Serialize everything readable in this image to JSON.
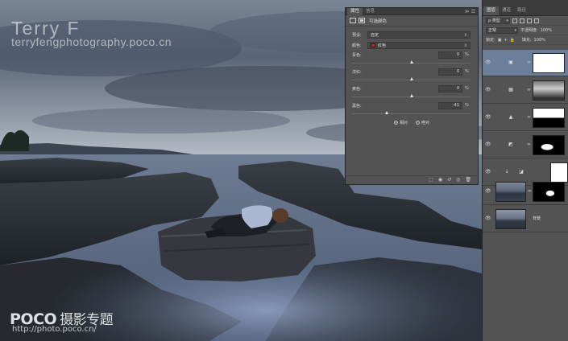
{
  "watermark": {
    "name": "Terry F",
    "site": "terryfengphotography.poco.cn",
    "logo": "POCO",
    "logo_sub": "摄影专题",
    "url": "http://photo.poco.cn/"
  },
  "properties": {
    "tabs": [
      "属性",
      "信息"
    ],
    "controls": "≫ ☰",
    "title": "可选颜色",
    "preset_label": "预设:",
    "preset_value": "自定",
    "color_label": "颜色:",
    "color_value": "红色",
    "sliders": [
      {
        "label": "青色:",
        "value": "0",
        "unit": "%",
        "percent": 0
      },
      {
        "label": "洋红:",
        "value": "0",
        "unit": "%",
        "percent": 0
      },
      {
        "label": "黄色:",
        "value": "0",
        "unit": "%",
        "percent": 0
      },
      {
        "label": "黑色:",
        "value": "-41",
        "unit": "%",
        "percent": -41
      }
    ],
    "radio_relative": "相对",
    "radio_absolute": "绝对",
    "radio_selected": "相对",
    "footer_icons": [
      "clip-icon",
      "view-previous-icon",
      "reset-icon",
      "visibility-icon",
      "delete-icon"
    ]
  },
  "layers": {
    "tabs": [
      "图层",
      "通道",
      "路径"
    ],
    "filter_label": "ρ 类型",
    "blend_mode": "正常",
    "opacity_label": "不透明度:",
    "opacity_value": "100%",
    "lock_label": "锁定:",
    "fill_label": "填充:",
    "fill_value": "100%",
    "items": [
      {
        "kind": "selective-color",
        "icon": "selective-color-icon",
        "selected": true
      },
      {
        "kind": "channel-mixer",
        "icon": "channel-mixer-icon",
        "selected": false
      },
      {
        "kind": "levels",
        "icon": "levels-icon",
        "selected": false
      },
      {
        "kind": "curves",
        "icon": "curves-icon",
        "selected": false
      },
      {
        "kind": "brightness",
        "icon": "brightness-icon",
        "selected": false
      },
      {
        "kind": "image",
        "selected": false
      },
      {
        "kind": "background",
        "name": "背景",
        "selected": false
      }
    ]
  }
}
